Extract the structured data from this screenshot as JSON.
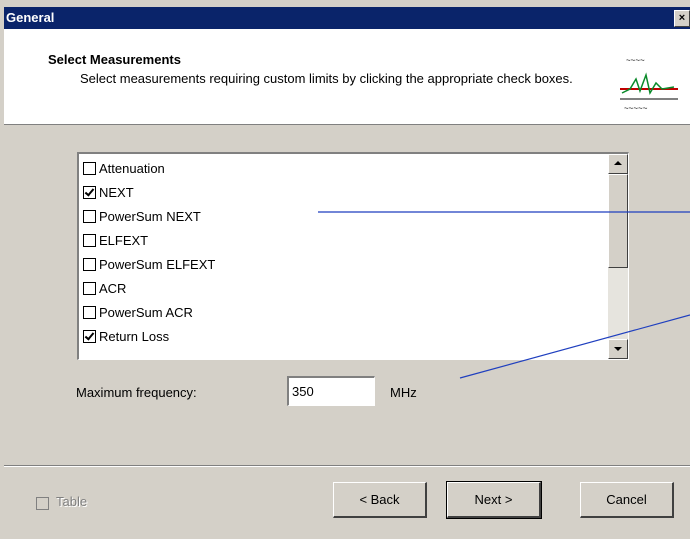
{
  "window": {
    "title": "General",
    "close_label": "×"
  },
  "header": {
    "title": "Select Measurements",
    "subtitle": "Select measurements requiring custom limits by clicking the appropriate check boxes."
  },
  "measurements": [
    {
      "label": "Attenuation",
      "checked": false
    },
    {
      "label": "NEXT",
      "checked": true
    },
    {
      "label": "PowerSum NEXT",
      "checked": false
    },
    {
      "label": "ELFEXT",
      "checked": false
    },
    {
      "label": "PowerSum ELFEXT",
      "checked": false
    },
    {
      "label": "ACR",
      "checked": false
    },
    {
      "label": "PowerSum ACR",
      "checked": false
    },
    {
      "label": "Return Loss",
      "checked": true
    }
  ],
  "frequency": {
    "label": "Maximum frequency:",
    "value": "350",
    "unit": "MHz"
  },
  "footer": {
    "table_label": "Table",
    "table_checked": false,
    "back_label": "< Back",
    "next_label": "Next >",
    "cancel_label": "Cancel"
  },
  "colors": {
    "titlebar": "#0a246a",
    "dialog": "#d4d0c8",
    "callout_line": "#1f3fbf"
  }
}
